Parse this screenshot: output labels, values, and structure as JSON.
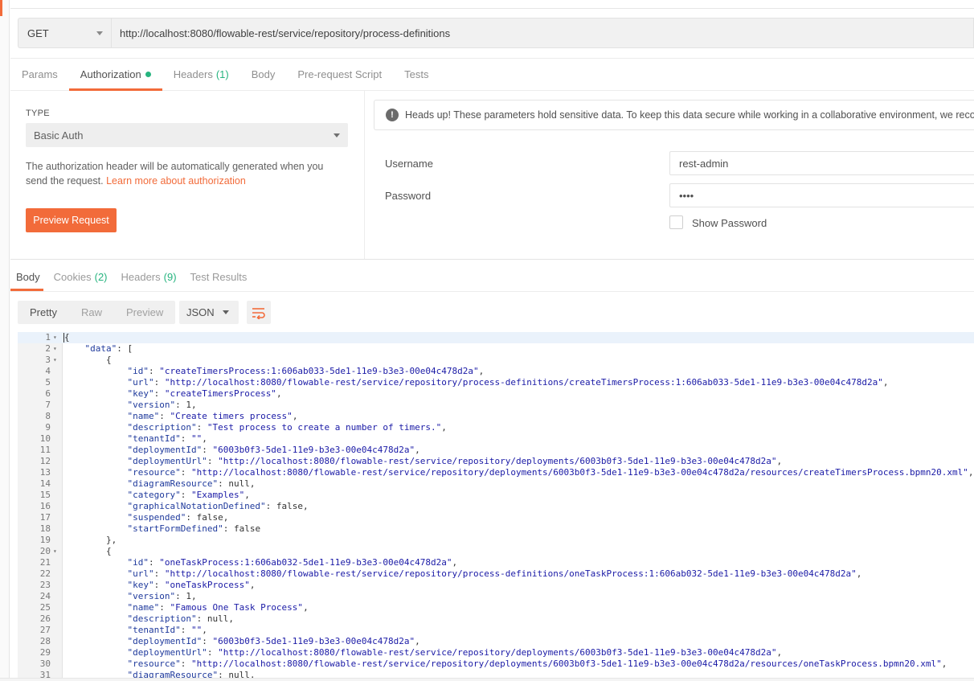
{
  "request": {
    "method": "GET",
    "url": "http://localhost:8080/flowable-rest/service/repository/process-definitions"
  },
  "request_tabs": [
    {
      "label": "Params",
      "count": ""
    },
    {
      "label": "Authorization",
      "count": ""
    },
    {
      "label": "Headers",
      "count": "(1)"
    },
    {
      "label": "Body",
      "count": ""
    },
    {
      "label": "Pre-request Script",
      "count": ""
    },
    {
      "label": "Tests",
      "count": ""
    }
  ],
  "auth": {
    "type_label": "TYPE",
    "type_value": "Basic Auth",
    "description": "The authorization header will be automatically generated when you send the request.",
    "learn_more": "Learn more about authorization",
    "preview_button": "Preview Request",
    "notice": "Heads up! These parameters hold sensitive data. To keep this data secure while working in a collaborative environment, we recommend using variables.",
    "username_label": "Username",
    "username_value": "rest-admin",
    "password_label": "Password",
    "password_value": "••••",
    "show_password_label": "Show Password"
  },
  "response_tabs": [
    {
      "label": "Body",
      "count": ""
    },
    {
      "label": "Cookies",
      "count": "(2)"
    },
    {
      "label": "Headers",
      "count": "(9)"
    },
    {
      "label": "Test Results",
      "count": ""
    }
  ],
  "view_modes": [
    "Pretty",
    "Raw",
    "Preview"
  ],
  "format": "JSON",
  "icons": {
    "wrap": "wrap-lines-icon",
    "info": "info-icon"
  },
  "colors": {
    "accent": "#f26b3a",
    "success": "#26b47f"
  },
  "code_lines": [
    "{",
    "    \"data\": [",
    "        {",
    "            \"id\": \"createTimersProcess:1:606ab033-5de1-11e9-b3e3-00e04c478d2a\",",
    "            \"url\": \"http://localhost:8080/flowable-rest/service/repository/process-definitions/createTimersProcess:1:606ab033-5de1-11e9-b3e3-00e04c478d2a\",",
    "            \"key\": \"createTimersProcess\",",
    "            \"version\": 1,",
    "            \"name\": \"Create timers process\",",
    "            \"description\": \"Test process to create a number of timers.\",",
    "            \"tenantId\": \"\",",
    "            \"deploymentId\": \"6003b0f3-5de1-11e9-b3e3-00e04c478d2a\",",
    "            \"deploymentUrl\": \"http://localhost:8080/flowable-rest/service/repository/deployments/6003b0f3-5de1-11e9-b3e3-00e04c478d2a\",",
    "            \"resource\": \"http://localhost:8080/flowable-rest/service/repository/deployments/6003b0f3-5de1-11e9-b3e3-00e04c478d2a/resources/createTimersProcess.bpmn20.xml\",",
    "            \"diagramResource\": null,",
    "            \"category\": \"Examples\",",
    "            \"graphicalNotationDefined\": false,",
    "            \"suspended\": false,",
    "            \"startFormDefined\": false",
    "        },",
    "        {",
    "            \"id\": \"oneTaskProcess:1:606ab032-5de1-11e9-b3e3-00e04c478d2a\",",
    "            \"url\": \"http://localhost:8080/flowable-rest/service/repository/process-definitions/oneTaskProcess:1:606ab032-5de1-11e9-b3e3-00e04c478d2a\",",
    "            \"key\": \"oneTaskProcess\",",
    "            \"version\": 1,",
    "            \"name\": \"Famous One Task Process\",",
    "            \"description\": null,",
    "            \"tenantId\": \"\",",
    "            \"deploymentId\": \"6003b0f3-5de1-11e9-b3e3-00e04c478d2a\",",
    "            \"deploymentUrl\": \"http://localhost:8080/flowable-rest/service/repository/deployments/6003b0f3-5de1-11e9-b3e3-00e04c478d2a\",",
    "            \"resource\": \"http://localhost:8080/flowable-rest/service/repository/deployments/6003b0f3-5de1-11e9-b3e3-00e04c478d2a/resources/oneTaskProcess.bpmn20.xml\",",
    "            \"diagramResource\": null,"
  ],
  "foldable_lines": [
    1,
    2,
    3,
    20
  ]
}
